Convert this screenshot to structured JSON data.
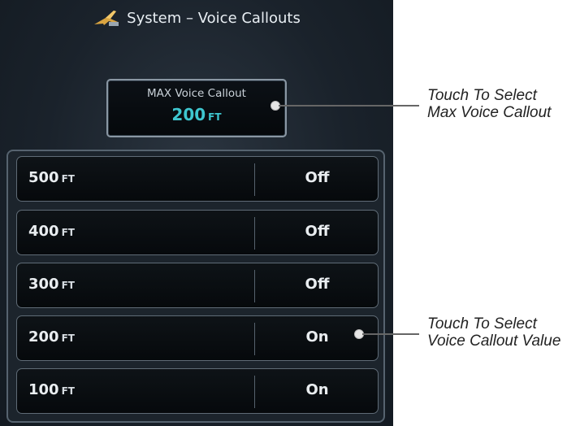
{
  "header": {
    "title": "System – Voice Callouts"
  },
  "max_callout": {
    "label": "MAX Voice Callout",
    "value": "200",
    "unit": "FT"
  },
  "rows": [
    {
      "altitude": "500",
      "unit": "FT",
      "state": "Off"
    },
    {
      "altitude": "400",
      "unit": "FT",
      "state": "Off"
    },
    {
      "altitude": "300",
      "unit": "FT",
      "state": "Off"
    },
    {
      "altitude": "200",
      "unit": "FT",
      "state": "On"
    },
    {
      "altitude": "100",
      "unit": "FT",
      "state": "On"
    }
  ],
  "annotations": {
    "max_callout": {
      "line1": "Touch To Select",
      "line2": "Max Voice Callout"
    },
    "callout_value": {
      "line1": "Touch To Select",
      "line2": "Voice Callout Value"
    }
  },
  "colors": {
    "accent_cyan": "#3ec6cf",
    "background": "#1a222b"
  }
}
